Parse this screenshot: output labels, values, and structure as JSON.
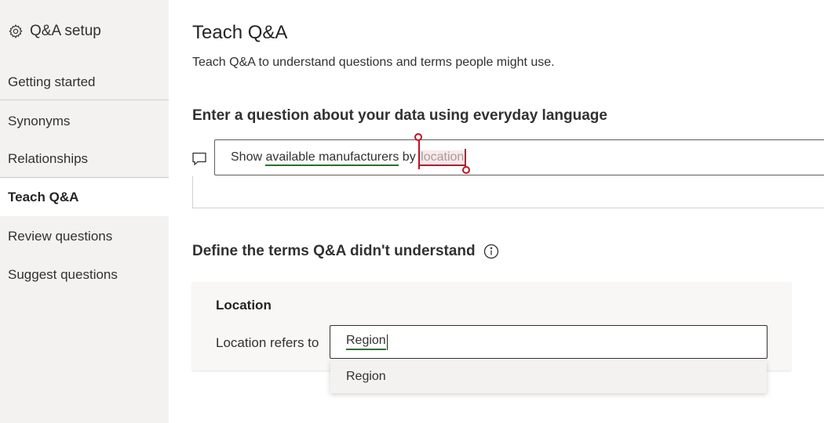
{
  "sidebar": {
    "title": "Q&A setup",
    "title_icon": "gear-icon",
    "items": [
      {
        "label": "Getting started"
      },
      {
        "label": "Synonyms"
      },
      {
        "label": "Relationships"
      },
      {
        "label": "Teach Q&A",
        "active": true
      },
      {
        "label": "Review questions"
      },
      {
        "label": "Suggest questions"
      }
    ]
  },
  "main": {
    "title": "Teach Q&A",
    "subtitle": "Teach Q&A to understand questions and terms people might use.",
    "question_label": "Enter a question about your data using everyday language",
    "question": {
      "part1": "Show ",
      "recognized": "available manufacturers",
      "part2": " by ",
      "unrecognized": "location"
    },
    "define_label": "Define the terms Q&A didn't understand",
    "term": {
      "title": "Location",
      "refers_label": "Location refers to",
      "value": "Region"
    },
    "suggestions": [
      "Region"
    ]
  },
  "colors": {
    "recognized_underline": "#107c10",
    "unrecognized_underline": "#c50f1f",
    "sidebar_bg": "#f3f2f1"
  }
}
